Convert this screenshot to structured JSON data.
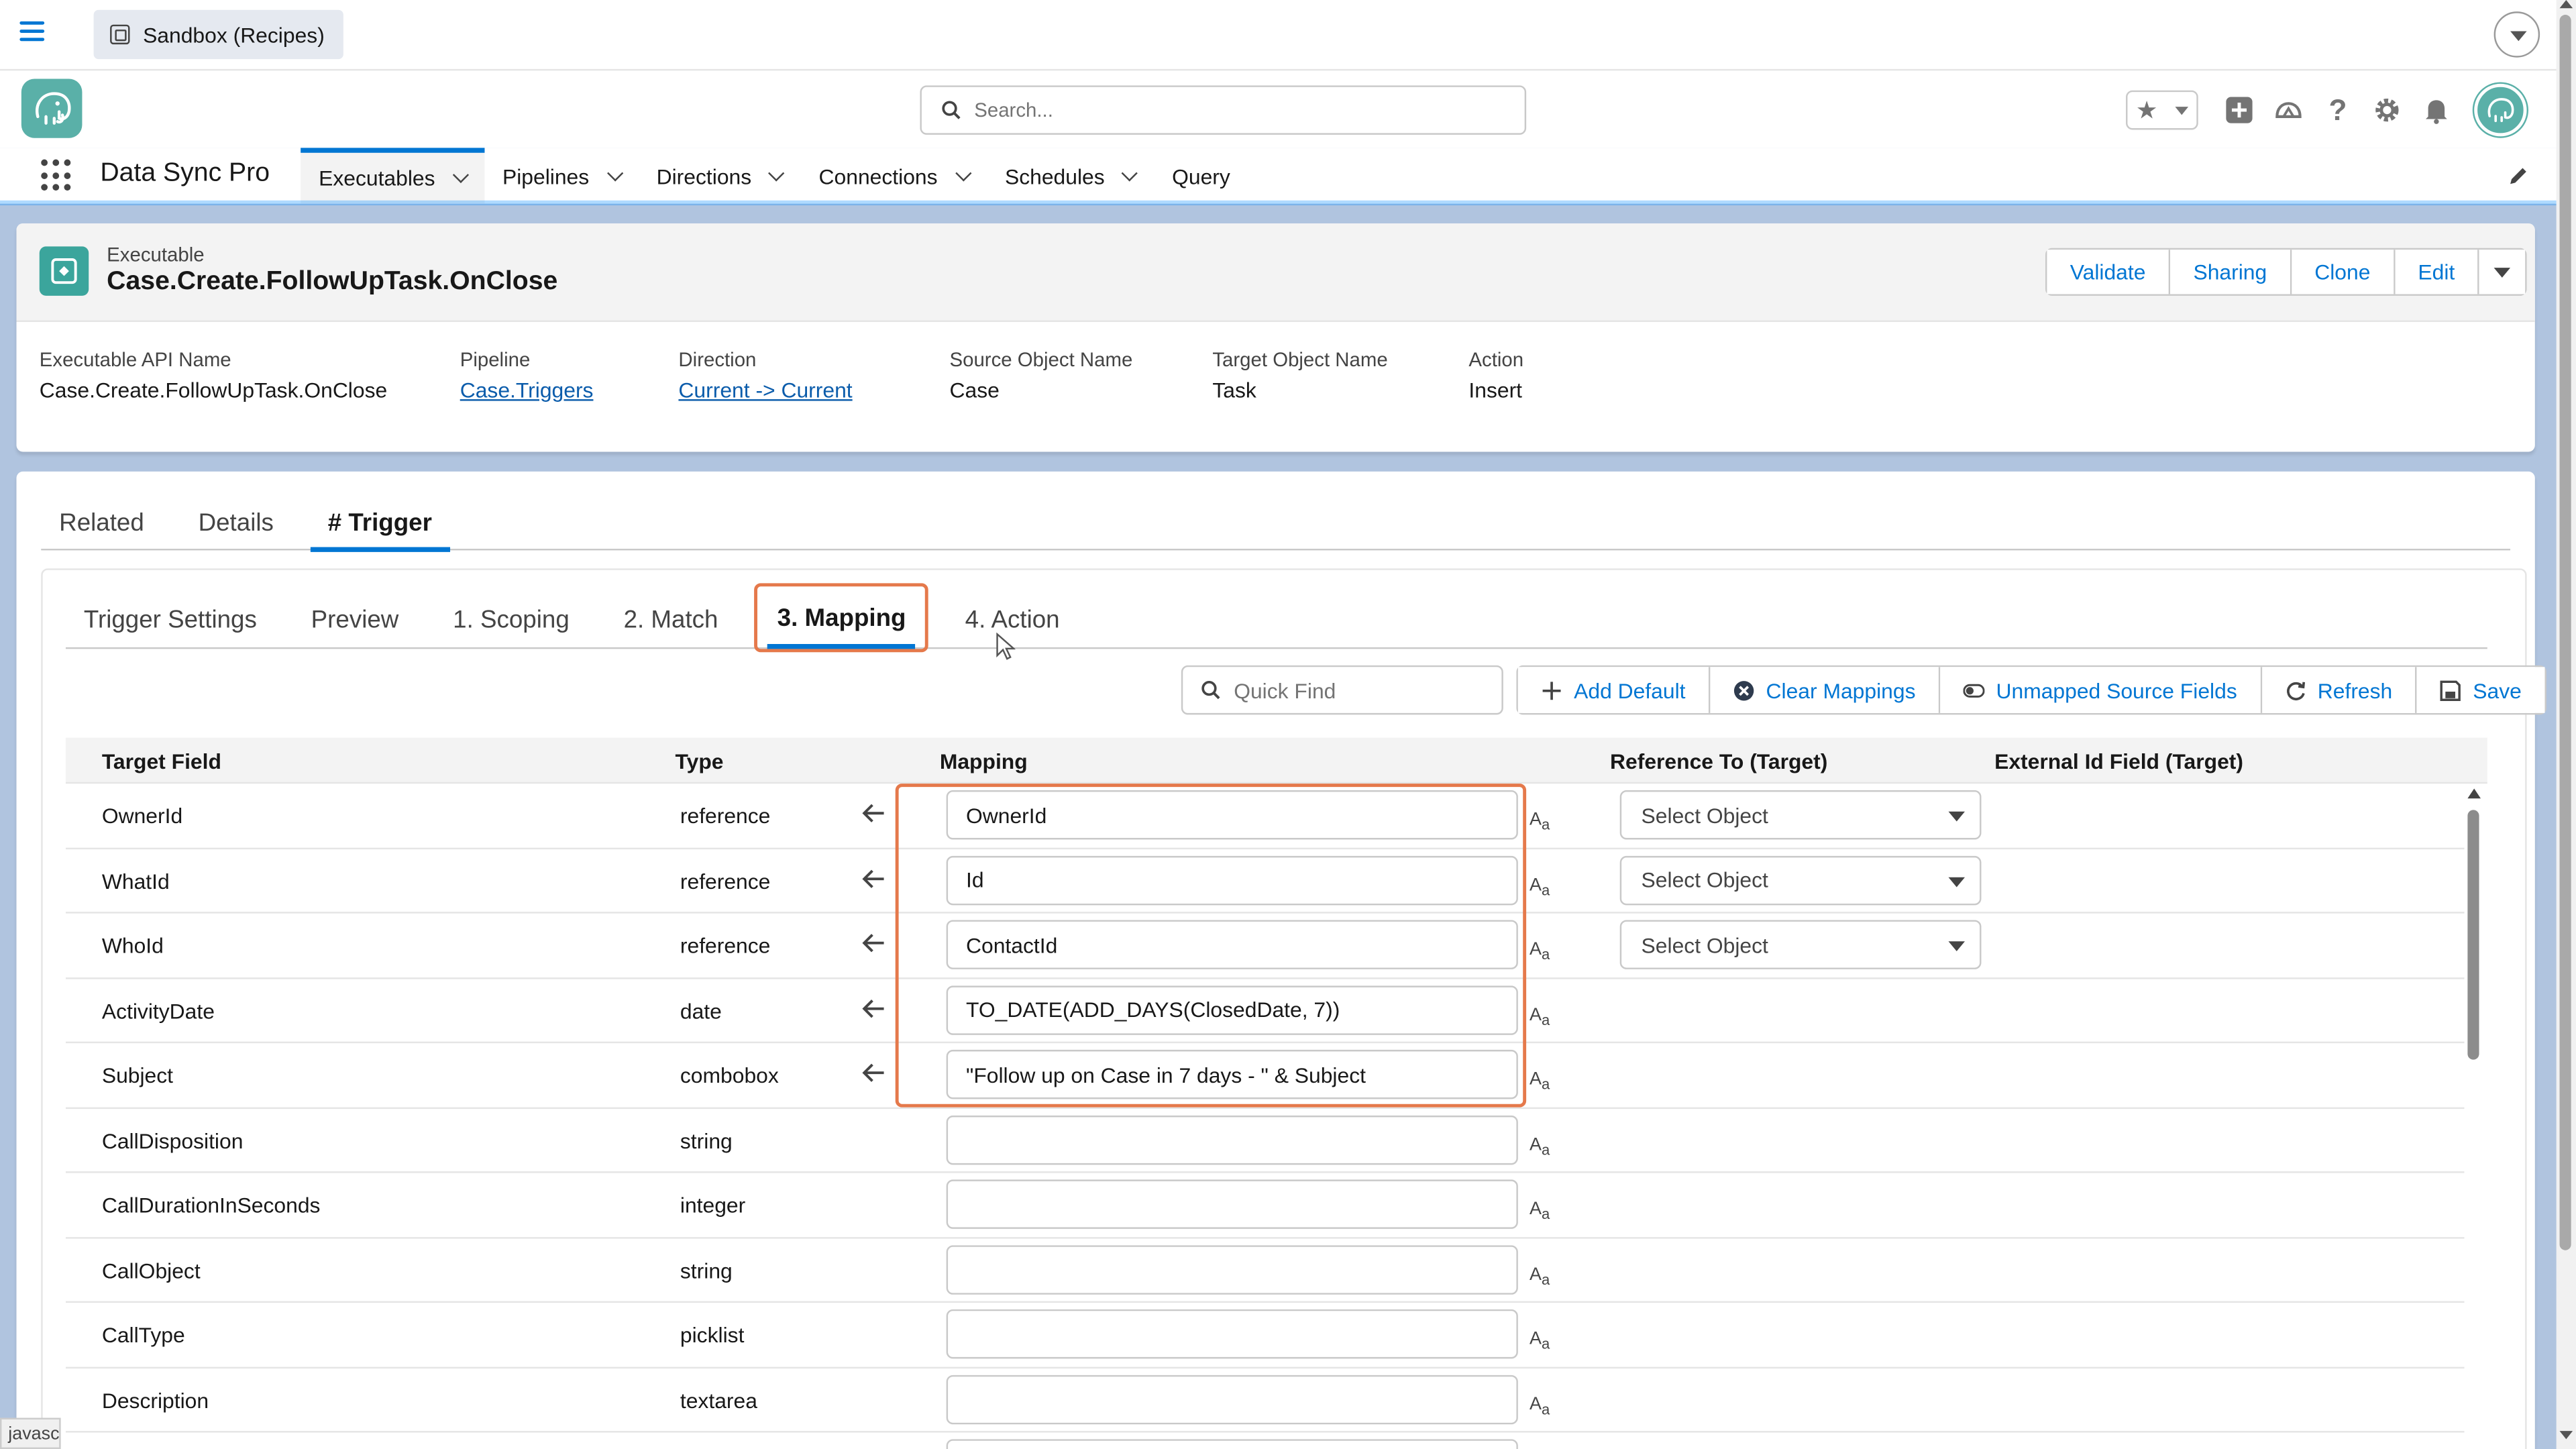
{
  "topbar": {
    "sandbox_label": "Sandbox (Recipes)"
  },
  "header": {
    "search_placeholder": "Search..."
  },
  "nav": {
    "app_name": "Data Sync Pro",
    "items": [
      {
        "label": "Executables",
        "has_menu": true,
        "active": true
      },
      {
        "label": "Pipelines",
        "has_menu": true
      },
      {
        "label": "Directions",
        "has_menu": true
      },
      {
        "label": "Connections",
        "has_menu": true
      },
      {
        "label": "Schedules",
        "has_menu": true
      },
      {
        "label": "Query",
        "has_menu": false
      }
    ]
  },
  "record": {
    "type": "Executable",
    "title": "Case.Create.FollowUpTask.OnClose",
    "actions": [
      "Validate",
      "Sharing",
      "Clone",
      "Edit"
    ],
    "fields": [
      {
        "label": "Executable API Name",
        "value": "Case.Create.FollowUpTask.OnClose",
        "link": false
      },
      {
        "label": "Pipeline",
        "value": "Case.Triggers",
        "link": true
      },
      {
        "label": "Direction",
        "value": "Current -> Current",
        "link": true
      },
      {
        "label": "Source Object Name",
        "value": "Case",
        "link": false
      },
      {
        "label": "Target Object Name",
        "value": "Task",
        "link": false
      },
      {
        "label": "Action",
        "value": "Insert",
        "link": false
      }
    ]
  },
  "tabs": [
    "Related",
    "Details",
    "# Trigger"
  ],
  "subtabs": [
    "Trigger Settings",
    "Preview",
    "1. Scoping",
    "2. Match",
    "3. Mapping",
    "4. Action"
  ],
  "toolbar": {
    "quick_find_placeholder": "Quick Find",
    "buttons": [
      "Add Default",
      "Clear Mappings",
      "Unmapped Source Fields",
      "Refresh",
      "Save"
    ]
  },
  "table": {
    "headers": {
      "target": "Target Field",
      "type": "Type",
      "mapping": "Mapping",
      "reference": "Reference To (Target)",
      "external": "External Id Field (Target)"
    },
    "select_placeholder": "Select Object",
    "rows": [
      {
        "target": "OwnerId",
        "type": "reference",
        "mapping": "OwnerId",
        "arrow": true,
        "select": true
      },
      {
        "target": "WhatId",
        "type": "reference",
        "mapping": "Id",
        "arrow": true,
        "select": true
      },
      {
        "target": "WhoId",
        "type": "reference",
        "mapping": "ContactId",
        "arrow": true,
        "select": true
      },
      {
        "target": "ActivityDate",
        "type": "date",
        "mapping": "TO_DATE(ADD_DAYS(ClosedDate, 7))",
        "arrow": true,
        "select": false
      },
      {
        "target": "Subject",
        "type": "combobox",
        "mapping": "\"Follow up on Case in 7 days - \" & Subject",
        "arrow": true,
        "select": false
      },
      {
        "target": "CallDisposition",
        "type": "string",
        "mapping": "",
        "arrow": false,
        "select": false
      },
      {
        "target": "CallDurationInSeconds",
        "type": "integer",
        "mapping": "",
        "arrow": false,
        "select": false
      },
      {
        "target": "CallObject",
        "type": "string",
        "mapping": "",
        "arrow": false,
        "select": false
      },
      {
        "target": "CallType",
        "type": "picklist",
        "mapping": "",
        "arrow": false,
        "select": false
      },
      {
        "target": "Description",
        "type": "textarea",
        "mapping": "",
        "arrow": false,
        "select": false
      },
      {
        "target": "",
        "type": "",
        "mapping": "",
        "arrow": false,
        "select": false
      }
    ]
  },
  "statusbar": {
    "text": "javascr"
  },
  "colors": {
    "brand_blue": "#0176d3",
    "highlight": "#e5794b",
    "app_icon": "#5ab0a8"
  }
}
